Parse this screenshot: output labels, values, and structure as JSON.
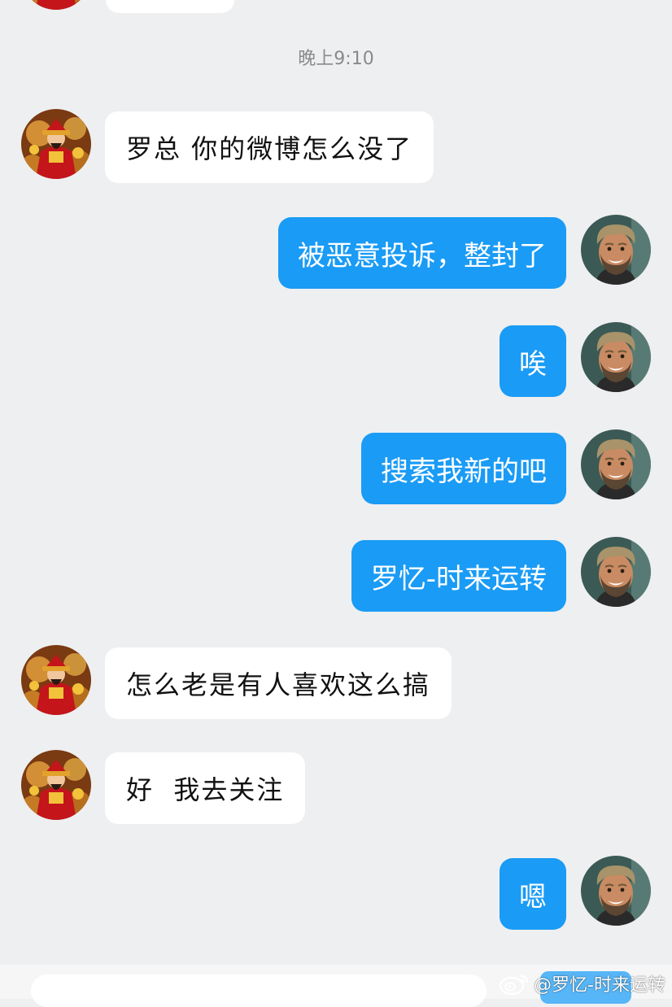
{
  "chat": {
    "timestamp": "晚上9:10",
    "messages": [
      {
        "side": "left",
        "text": "罗总 你的微博怎么没了"
      },
      {
        "side": "right",
        "text": "被恶意投诉，整封了"
      },
      {
        "side": "right",
        "text": "唉"
      },
      {
        "side": "right",
        "text": "搜索我新的吧"
      },
      {
        "side": "right",
        "text": "罗忆-时来运转"
      },
      {
        "side": "left",
        "text": "怎么老是有人喜欢这么搞"
      },
      {
        "side": "left",
        "text": "好  我去关注"
      },
      {
        "side": "right",
        "text": "嗯"
      }
    ]
  },
  "avatars": {
    "contact": "caishen-avatar-icon",
    "me": "smiling-bearded-man-avatar-icon"
  },
  "colors": {
    "background": "#eeeff1",
    "outgoing_bubble": "#1a9bf5",
    "incoming_bubble": "#ffffff",
    "timestamp": "#8a8a8a"
  },
  "watermark": {
    "text": "@罗忆-时来运转",
    "icon": "weibo-logo-icon"
  }
}
